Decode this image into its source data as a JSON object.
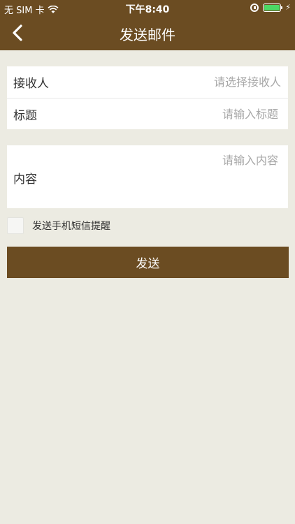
{
  "status_bar": {
    "carrier": "无 SIM 卡",
    "time": "下午8:40",
    "battery_charging": true
  },
  "nav": {
    "title": "发送邮件",
    "back_icon": "chevron-left-icon",
    "background_color": "#6b4c22"
  },
  "form": {
    "recipient_label": "接收人",
    "recipient_placeholder": "请选择接收人",
    "subject_label": "标题",
    "subject_placeholder": "请输入标题",
    "content_label": "内容",
    "content_placeholder": "请输入内容",
    "sms_reminder_label": "发送手机短信提醒",
    "sms_reminder_checked": false,
    "send_label": "发送"
  },
  "colors": {
    "accent": "#6b4c22",
    "background": "#ecebe2",
    "battery": "#4cd964"
  }
}
